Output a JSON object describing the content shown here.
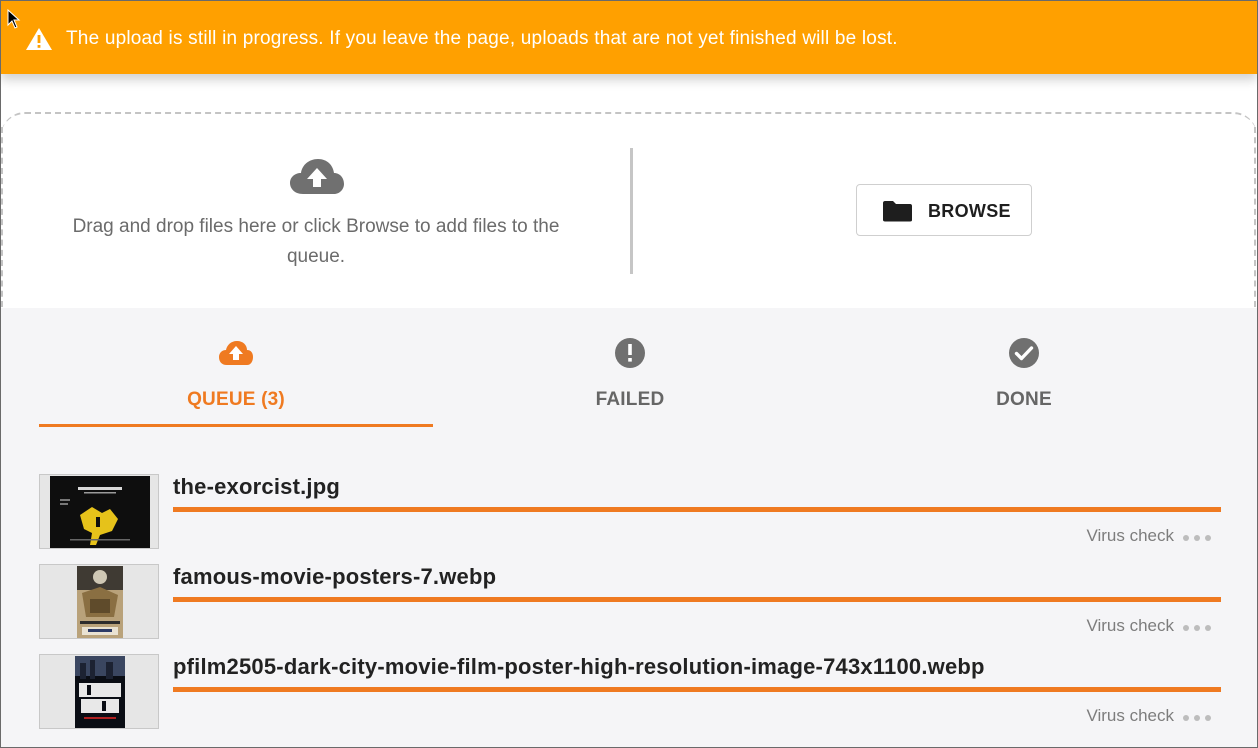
{
  "banner": {
    "message": "The upload is still in progress. If you leave the page, uploads that are not yet finished will be lost.",
    "icon": "warning-icon",
    "color": "#ffa000"
  },
  "dropzone": {
    "icon": "cloud-upload-icon",
    "instructions": "Drag and drop files here or click Browse to add files to the queue.",
    "browse_label": "BROWSE",
    "browse_icon": "folder-icon"
  },
  "tabs": [
    {
      "label": "QUEUE (3)",
      "icon": "cloud-upload-icon",
      "active": true
    },
    {
      "label": "FAILED",
      "icon": "error-icon",
      "active": false
    },
    {
      "label": "DONE",
      "icon": "check-circle-icon",
      "active": false
    }
  ],
  "accent_color": "#ef7a21",
  "files": [
    {
      "name": "the-exorcist.jpg",
      "status": "Virus check",
      "progress": 1.0,
      "thumbnail": "the-exorcist-poster-thumbnail"
    },
    {
      "name": "famous-movie-posters-7.webp",
      "status": "Virus check",
      "progress": 1.0,
      "thumbnail": "star-wars-poster-thumbnail"
    },
    {
      "name": "pfilm2505-dark-city-movie-film-poster-high-resolution-image-743x1100.webp",
      "status": "Virus check",
      "progress": 1.0,
      "thumbnail": "dark-city-poster-thumbnail"
    }
  ]
}
